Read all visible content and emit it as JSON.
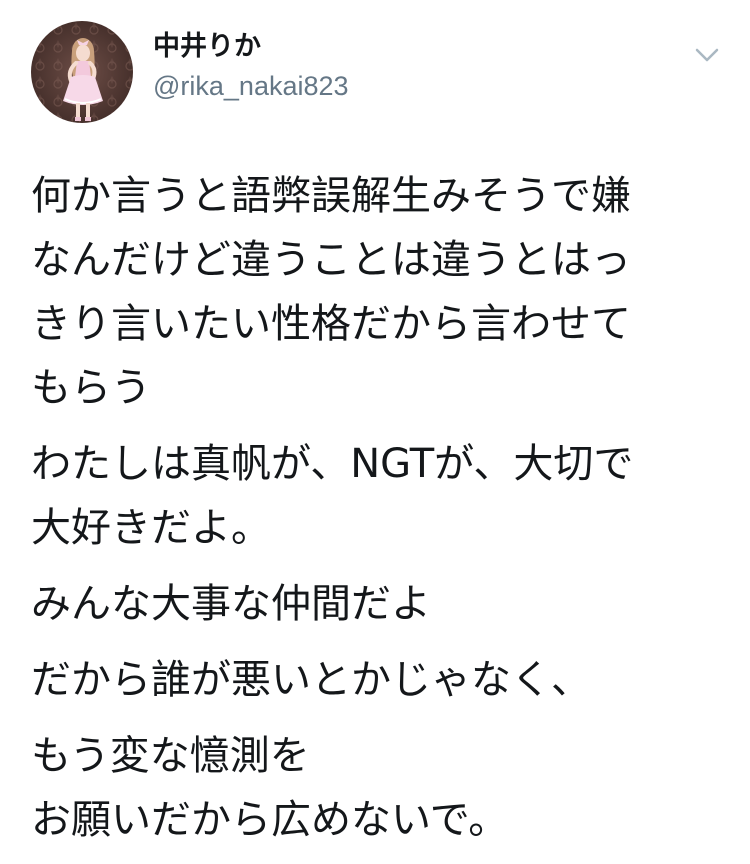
{
  "tweet": {
    "author": {
      "display_name": "中井りか",
      "handle": "@rika_nakai823",
      "avatar_icon": "profile-photo-avatar"
    },
    "menu_icon": "chevron-down-icon",
    "paragraphs": [
      "何か言うと語弊誤解生みそうで嫌\nなんだけど違うことは違うとはっ\nきり言いたい性格だから言わせて\nもらう",
      "わたしは真帆が、NGTが、大切で\n大好きだよ。",
      "みんな大事な仲間だよ",
      "だから誰が悪いとかじゃなく、",
      "もう変な憶測を\nお願いだから広めないで。"
    ]
  },
  "colors": {
    "text_primary": "#14171a",
    "text_secondary": "#657786",
    "chevron": "#aab8c2",
    "background": "#ffffff"
  }
}
